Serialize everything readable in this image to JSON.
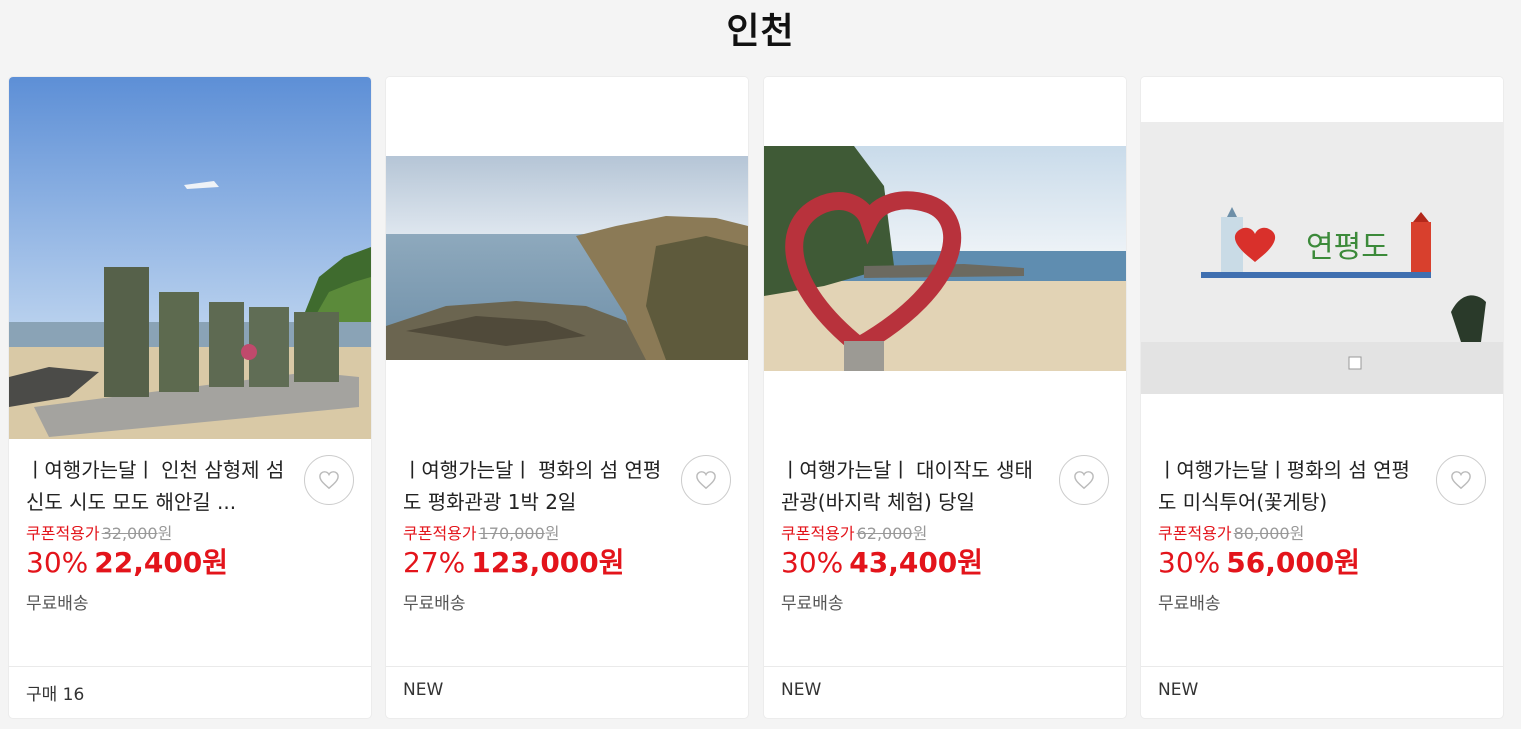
{
  "section": {
    "title": "인천"
  },
  "products": [
    {
      "title": "ㅣ여행가는달ㅣ 인천 삼형제 섬 신도 시도 모도 해안길 ...",
      "coupon_label": "쿠폰적용가",
      "original_price": "32,000",
      "original_currency": "원",
      "discount": "30%",
      "price": "22,400원",
      "shipping": "무료배송",
      "footer": "구매 16",
      "image_icon": "modo-island-sign-photo"
    },
    {
      "title": "ㅣ여행가는달ㅣ 평화의 섬 연평도 평화관광 1박 2일",
      "coupon_label": "쿠폰적용가",
      "original_price": "170,000",
      "original_currency": "원",
      "discount": "27%",
      "price": "123,000원",
      "shipping": "무료배송",
      "footer": "NEW",
      "image_icon": "coastline-photo"
    },
    {
      "title": "ㅣ여행가는달ㅣ 대이작도 생태관광(바지락 체험) 당일",
      "coupon_label": "쿠폰적용가",
      "original_price": "62,000",
      "original_currency": "원",
      "discount": "30%",
      "price": "43,400원",
      "shipping": "무료배송",
      "footer": "NEW",
      "image_icon": "heart-sculpture-beach-photo"
    },
    {
      "title": "ㅣ여행가는달ㅣ평화의 섬 연평도 미식투어(꽃게탕)",
      "coupon_label": "쿠폰적용가",
      "original_price": "80,000",
      "original_currency": "원",
      "discount": "30%",
      "price": "56,000원",
      "shipping": "무료배송",
      "footer": "NEW",
      "image_icon": "yeonpyeongdo-wall-mural-photo",
      "image_text": "연평도"
    }
  ],
  "colors": {
    "accent": "#e3141b",
    "background": "#f4f4f4"
  }
}
